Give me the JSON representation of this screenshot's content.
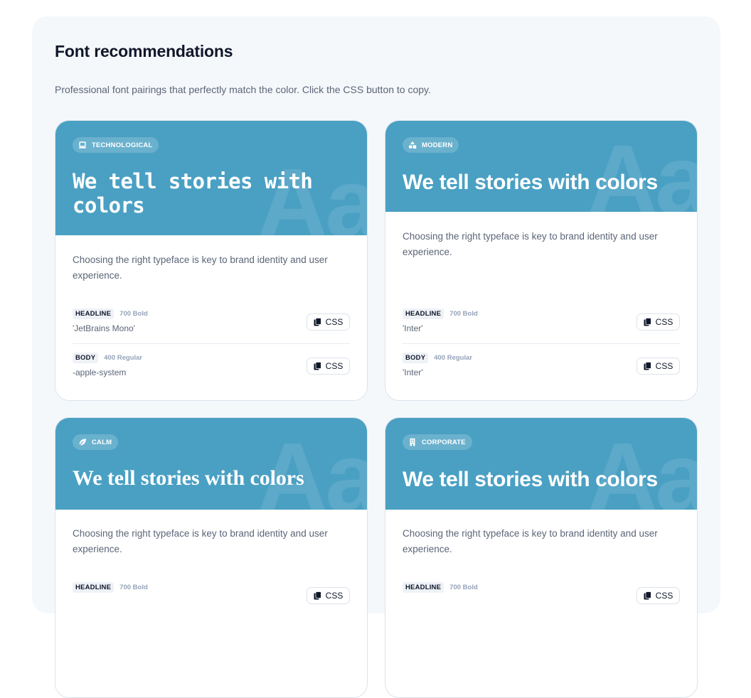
{
  "section": {
    "title": "Font recommendations",
    "subtitle": "Professional font pairings that perfectly match the color. Click the CSS button to copy."
  },
  "accent_color": "#4aa0c3",
  "watermark": "Aa",
  "css_label": "CSS",
  "cards": [
    {
      "tag": "TECHNOLOGICAL",
      "tag_icon": "laptop-icon",
      "sample": "We tell stories with colors",
      "description": "Choosing the right typeface is key to brand identity and user experience.",
      "headline": {
        "role": "HEADLINE",
        "weight": "700 Bold",
        "family": "'JetBrains Mono'"
      },
      "body": {
        "role": "BODY",
        "weight": "400 Regular",
        "family": "-apple-system"
      }
    },
    {
      "tag": "MODERN",
      "tag_icon": "shapes-icon",
      "sample": "We tell stories with colors",
      "description": "Choosing the right typeface is key to brand identity and user experience.",
      "headline": {
        "role": "HEADLINE",
        "weight": "700 Bold",
        "family": "'Inter'"
      },
      "body": {
        "role": "BODY",
        "weight": "400 Regular",
        "family": "'Inter'"
      }
    },
    {
      "tag": "CALM",
      "tag_icon": "leaf-icon",
      "sample": "We tell stories with colors",
      "description": "Choosing the right typeface is key to brand identity and user experience.",
      "headline": {
        "role": "HEADLINE",
        "weight": "700 Bold"
      }
    },
    {
      "tag": "CORPORATE",
      "tag_icon": "building-icon",
      "sample": "We tell stories with colors",
      "description": "Choosing the right typeface is key to brand identity and user experience.",
      "headline": {
        "role": "HEADLINE",
        "weight": "700 Bold"
      }
    }
  ]
}
